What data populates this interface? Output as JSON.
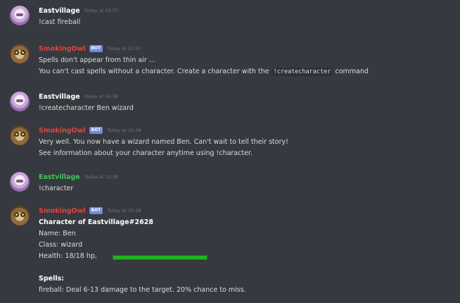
{
  "colors": {
    "background": "#36393f",
    "username_default": "#ffffff",
    "username_bot": "#e0443a",
    "username_green": "#43c25b",
    "bot_badge": "#7289da",
    "health_bar": "#1fb51c"
  },
  "messages": [
    {
      "author": "Eastvillage",
      "avatar_icon": "anime-girl-avatar-icon",
      "timestamp": "Today at 10:37",
      "lines": [
        "!cast fireball"
      ]
    },
    {
      "author": "SmokingOwl",
      "bot_badge": "BOT",
      "avatar_icon": "owl-avatar-icon",
      "timestamp": "Today at 10:37",
      "lines": [
        "Spells don't appear from thin air ...",
        "You can't cast spells without a character. Create a character with the "
      ],
      "code": "!createcharacter",
      "after_code": " command"
    },
    {
      "author": "Eastvillage",
      "avatar_icon": "anime-girl-avatar-icon",
      "timestamp": "Today at 10:38",
      "lines": [
        "!createcharacter Ben wizard"
      ]
    },
    {
      "author": "SmokingOwl",
      "bot_badge": "BOT",
      "avatar_icon": "owl-avatar-icon",
      "timestamp": "Today at 10:38",
      "lines": [
        "Very well. You now have a wizard named Ben. Can't wait to tell their story!",
        "See information about your character anytime using !character."
      ]
    },
    {
      "author": "Eastvillage",
      "avatar_icon": "anime-girl-avatar-icon",
      "timestamp": "Today at 10:38",
      "lines": [
        "!character"
      ]
    },
    {
      "author": "SmokingOwl",
      "bot_badge": "BOT",
      "avatar_icon": "owl-avatar-icon",
      "timestamp": "Today at 10:38",
      "character_title": "Character of Eastvillage#2628",
      "name_line": "Name: Ben",
      "class_line": "Class: wizard",
      "health_line": "Health: 18/18 hp,",
      "health_fraction": 1.0,
      "spells_title": "Spells:",
      "spell_line": "fireball: Deal 6-13 damage to the target. 20% chance to miss."
    }
  ]
}
